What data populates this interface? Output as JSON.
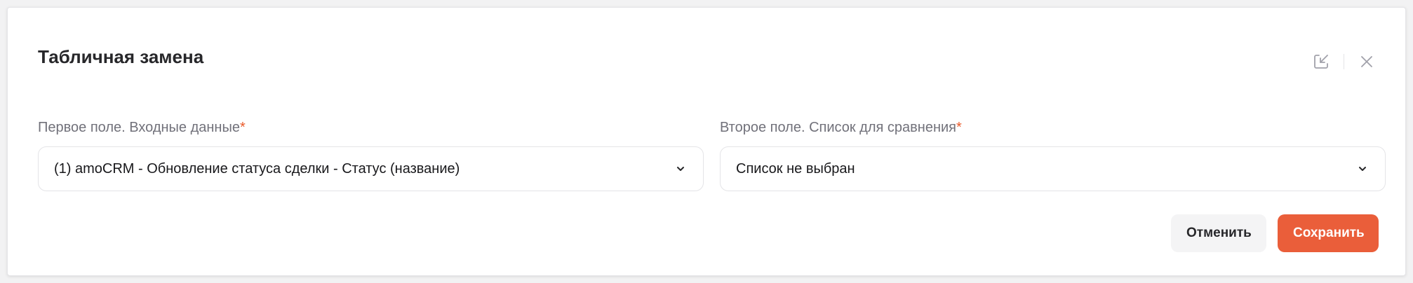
{
  "dialog": {
    "title": "Табличная замена",
    "icons": {
      "collapse": "collapse-arrow-icon",
      "close": "close-icon"
    }
  },
  "fields": {
    "first": {
      "label": "Первое поле. Входные данные",
      "required_mark": "*",
      "value": "(1) amoCRM - Обновление статуса сделки - Статус (название)",
      "icon": "chevron-down-icon"
    },
    "second": {
      "label": "Второе поле. Список для сравнения",
      "required_mark": "*",
      "value": "Список не выбран",
      "icon": "chevron-down-icon"
    }
  },
  "buttons": {
    "cancel_label": "Отменить",
    "save_label": "Сохранить"
  },
  "colors": {
    "accent": "#ea5e3a",
    "required": "#ea5a2a"
  }
}
